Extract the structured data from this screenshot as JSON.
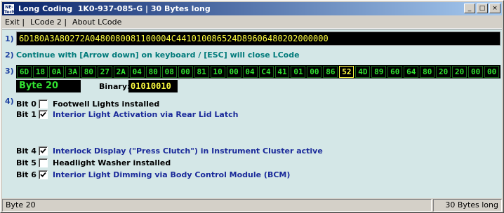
{
  "window": {
    "icon_text": "NE-Tech",
    "title": "Long Coding  1K0-937-085-G | 30 Bytes long",
    "buttons": {
      "minimize": "_",
      "maximize": "□",
      "close": "×"
    }
  },
  "menu": {
    "items": [
      {
        "label": "Exit |"
      },
      {
        "label": "LCode 2 |"
      },
      {
        "label": "About LCode"
      }
    ]
  },
  "steps": {
    "s1": "1)",
    "s2": "2)",
    "s3": "3)",
    "s4": "4)"
  },
  "coding": {
    "value": "6D180A3A80272A0480080081100004C441010086524D89606480202000000"
  },
  "hint": "Continue with [Arrow down] on keyboard / [ESC] will close LCode",
  "bytes": [
    "6D",
    "18",
    "0A",
    "3A",
    "80",
    "27",
    "2A",
    "04",
    "80",
    "08",
    "00",
    "81",
    "10",
    "00",
    "04",
    "C4",
    "41",
    "01",
    "00",
    "86",
    "52",
    "4D",
    "89",
    "60",
    "64",
    "80",
    "20",
    "20",
    "00",
    "00"
  ],
  "selected_byte_index": 20,
  "byte_label": "Byte 20",
  "binary": {
    "label": "Binary:",
    "value": "01010010"
  },
  "bits": [
    {
      "name": "Bit 0",
      "checked": false,
      "desc": "Footwell Lights installed"
    },
    {
      "name": "Bit 1",
      "checked": true,
      "desc": "Interior Light Activation via Rear Lid Latch"
    },
    {
      "name": "Bit 4",
      "checked": true,
      "desc": "Interlock Display (\"Press Clutch\") in Instrument Cluster active"
    },
    {
      "name": "Bit 5",
      "checked": false,
      "desc": "Headlight Washer installed"
    },
    {
      "name": "Bit 6",
      "checked": true,
      "desc": "Interior Light Dimming via Body Control Module (BCM)"
    }
  ],
  "status": {
    "left": "Byte 20",
    "right": "30 Bytes long"
  }
}
